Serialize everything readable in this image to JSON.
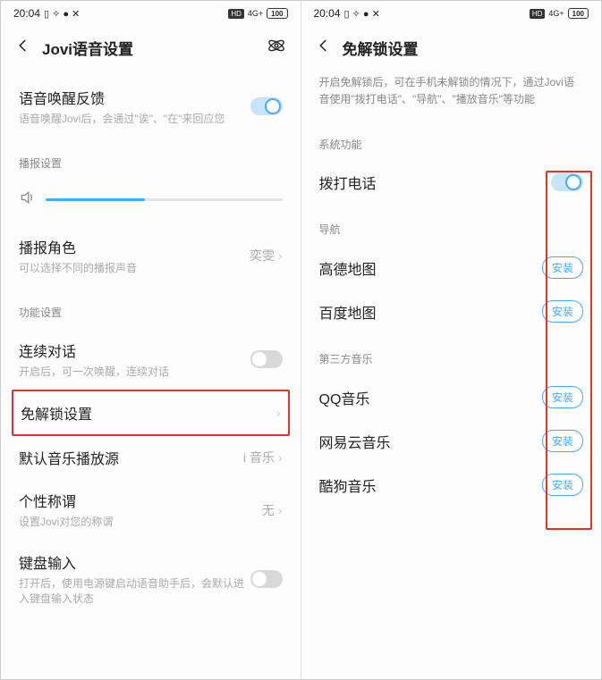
{
  "status": {
    "time": "20:04",
    "icons_left": "◧ ✕ ● ✕",
    "hd": "HD",
    "net": "4G+",
    "sig": "⁴⁶⁺ ₊ıll",
    "batt": "100"
  },
  "left_screen": {
    "title": "Jovi语音设置",
    "wake": {
      "title": "语音唤醒反馈",
      "sub": "语音唤醒Jovi后，会通过\"诶\"、\"在\"来回应您"
    },
    "broadcast_section": "播报设置",
    "role": {
      "title": "播报角色",
      "sub": "可以选择不同的播报声音",
      "value": "奕雯"
    },
    "func_section": "功能设置",
    "continuous": {
      "title": "连续对话",
      "sub": "开启后，可一次唤醒，连续对话"
    },
    "unlock": {
      "title": "免解锁设置"
    },
    "music": {
      "title": "默认音乐播放源",
      "value": "i 音乐"
    },
    "nickname": {
      "title": "个性称谓",
      "sub": "设置Jovi对您的称谓",
      "value": "无"
    },
    "keyboard": {
      "title": "键盘输入",
      "sub": "打开后，使用电源键启动语音助手后，会默认进入键盘输入状态"
    }
  },
  "right_screen": {
    "title": "免解锁设置",
    "desc": "开启免解锁后，可在手机未解锁的情况下，通过Jovi语音使用\"拨打电话\"、\"导航\"、\"播放音乐\"等功能",
    "sys_section": "系统功能",
    "dial": "拨打电话",
    "nav_section": "导航",
    "gaode": "高德地图",
    "baidu": "百度地图",
    "music_section": "第三方音乐",
    "qq": "QQ音乐",
    "netease": "网易云音乐",
    "kugou": "酷狗音乐",
    "install": "安装"
  }
}
